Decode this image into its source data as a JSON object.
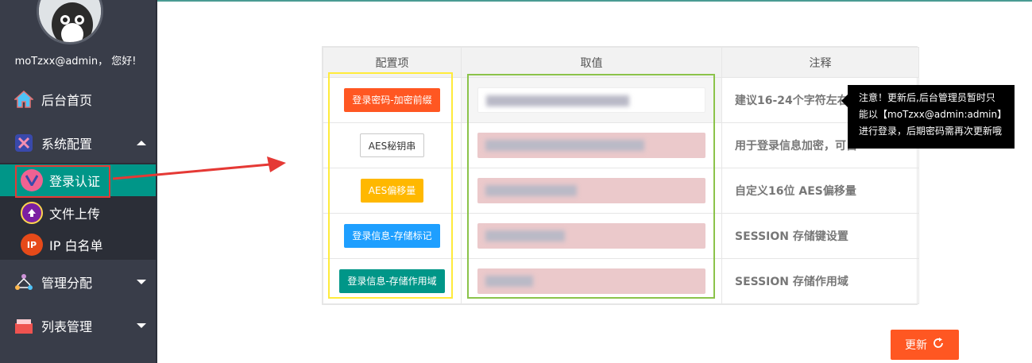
{
  "sidebar": {
    "greeting": "moTzxx@admin， 您好!",
    "menu": [
      {
        "label": "后台首页",
        "icon": "home-icon"
      },
      {
        "label": "系统配置",
        "icon": "tools-icon"
      },
      {
        "label": "管理分配",
        "icon": "org-icon"
      },
      {
        "label": "列表管理",
        "icon": "list-icon"
      }
    ],
    "submenu": [
      {
        "label": "登录认证",
        "icon": "v-icon",
        "color": "#f06292"
      },
      {
        "label": "文件上传",
        "icon": "upload-icon",
        "color": "#7b1fa2"
      },
      {
        "label": "IP 白名单",
        "icon_text": "IP",
        "icon": "ip-icon",
        "color": "#e64a19"
      }
    ]
  },
  "table": {
    "headers": [
      "配置项",
      "取值",
      "注释"
    ],
    "rows": [
      {
        "label": "登录密码-加密前缀",
        "color": "#ff5722",
        "note": "建议16-24个字符左右"
      },
      {
        "label": "AES秘钥串",
        "color": "#ffffff",
        "note": "用于登录信息加密，可自"
      },
      {
        "label": "AES偏移量",
        "color": "#ffb800",
        "note": "自定义16位 AES偏移量"
      },
      {
        "label": "登录信息-存储标记",
        "color": "#1e9fff",
        "note": "SESSION 存储键设置"
      },
      {
        "label": "登录信息-存储作用域",
        "color": "#009688",
        "note": "SESSION 存储作用域"
      }
    ]
  },
  "tooltip": {
    "line1": "注意！更新后,后台管理员暂时只",
    "line2": "能以【moTzxx@admin:admin】",
    "line3": "进行登录，后期密码需再次更新哦"
  },
  "update_button": {
    "label": "更新",
    "color": "#ff5722"
  }
}
